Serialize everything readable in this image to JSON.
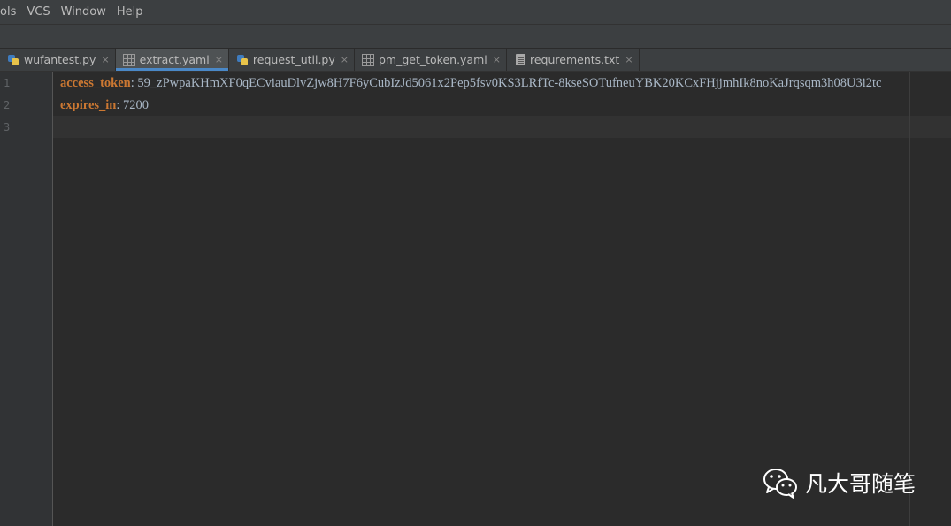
{
  "menu": [
    "ols",
    "VCS",
    "Window",
    "Help"
  ],
  "tabs": [
    {
      "label": "wufantest.py",
      "icon": "python-file-icon"
    },
    {
      "label": "extract.yaml",
      "icon": "yaml-file-icon",
      "active": true
    },
    {
      "label": "request_util.py",
      "icon": "python-file-icon"
    },
    {
      "label": "pm_get_token.yaml",
      "icon": "yaml-file-icon"
    },
    {
      "label": "requrements.txt",
      "icon": "text-file-icon"
    }
  ],
  "tab_close_glyph": "×",
  "gutter": {
    "line_numbers": [
      "1",
      "2",
      "3"
    ]
  },
  "editor": {
    "lines": [
      {
        "key": "access_token",
        "sep": ": ",
        "value": "59_zPwpaKHmXF0qECviauDlvZjw8H7F6yCubIzJd5061x2Pep5fsv0KS3LRfTc-8kseSOTufneuYBK20KCxFHjjmhIk8noKaJrqsqm3h08U3i2tc"
      },
      {
        "key": "expires_in",
        "sep": ": ",
        "value": "7200"
      },
      {
        "key": "",
        "sep": "",
        "value": ""
      }
    ]
  },
  "watermark": {
    "text": "凡大哥随笔",
    "icon": "wechat-icon"
  },
  "colors": {
    "background": "#2b2b2b",
    "yaml_key": "#cc7832",
    "yaml_value": "#a9b7c6",
    "active_tab_underline": "#4a88c7"
  }
}
